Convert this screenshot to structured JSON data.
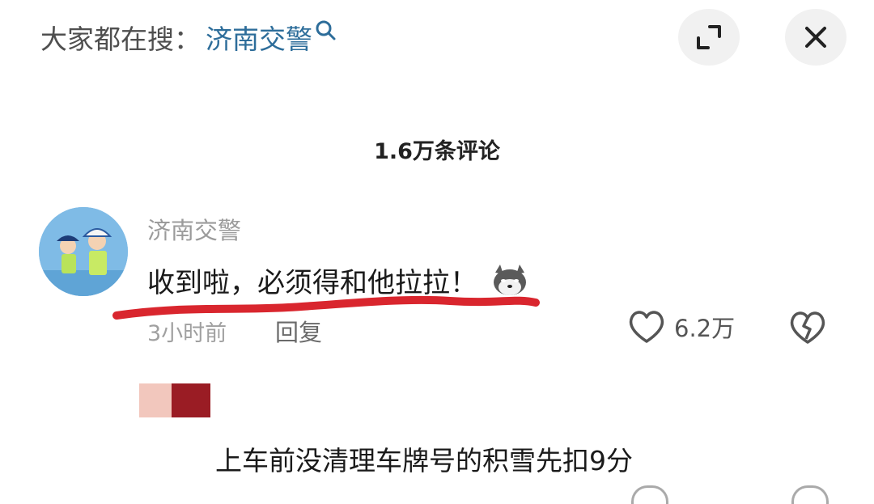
{
  "search_hint": {
    "prefix": "大家都在搜：",
    "keyword": "济南交警"
  },
  "comments_header": {
    "count_label": "1.6万条评论"
  },
  "comment1": {
    "author": "济南交警",
    "text": "收到啦，必须得和他拉拉！",
    "time": "3小时前",
    "reply_label": "回复",
    "like_count": "6.2万",
    "emoji": "dog-face"
  },
  "comment2": {
    "text": "上车前没清理车牌号的积雪先扣9分"
  },
  "icons": {
    "search": "search-icon",
    "expand": "expand-icon",
    "close": "close-icon",
    "like": "heart-outline-icon",
    "dislike": "broken-heart-icon"
  },
  "colors": {
    "keyword": "#2d6d9a",
    "annotation": "#d9262e",
    "secondary_text": "#9b9b9b"
  }
}
